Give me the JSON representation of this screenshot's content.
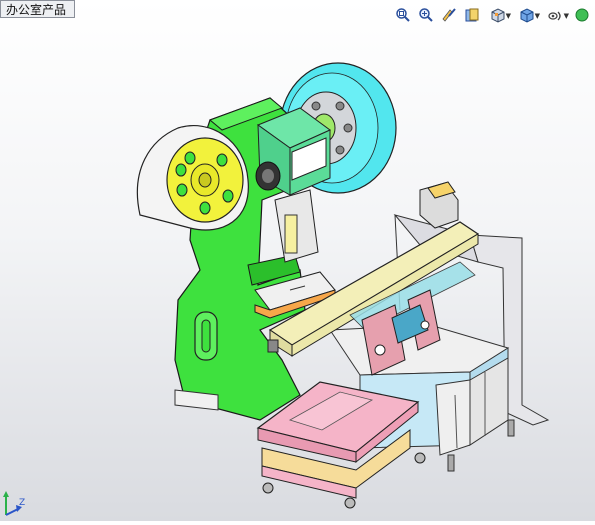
{
  "document_tab": {
    "label": "办公室产品"
  },
  "toolbar": {
    "buttons": [
      {
        "name": "zoom-to-fit-icon",
        "dropdown": false
      },
      {
        "name": "zoom-to-area-icon",
        "dropdown": false
      },
      {
        "name": "previous-view-icon",
        "dropdown": false
      },
      {
        "name": "section-view-icon",
        "dropdown": false
      },
      {
        "name": "view-orientation-icon",
        "dropdown": true
      },
      {
        "name": "display-style-icon",
        "dropdown": true
      },
      {
        "name": "hide-show-items-icon",
        "dropdown": true
      },
      {
        "name": "edit-appearance-icon",
        "dropdown": false
      }
    ]
  },
  "colors": {
    "frame_green": "#3ee13e",
    "flywheel_cyan": "#52e6ee",
    "hub_yellow": "#f2f23c",
    "cover_white": "#f4f4f4",
    "table_pink": "#f5b4c8",
    "cabinet_blue": "#c6e8f6",
    "feeder_beige": "#f3efb8",
    "frame_gray": "#e6e6ea"
  },
  "triad": {
    "axis_label": "Z"
  }
}
